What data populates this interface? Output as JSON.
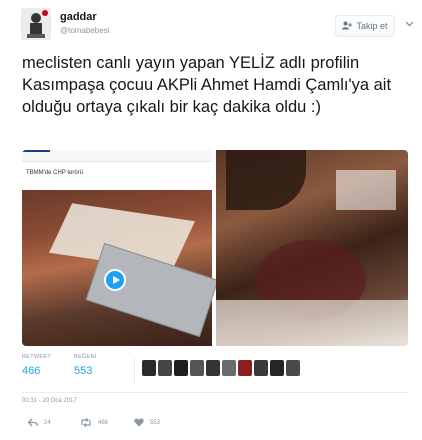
{
  "header": {
    "display_name": "gaddar",
    "handle": "@tomabebesi",
    "follow_label": "Takip et"
  },
  "tweet": {
    "text": "meclisten canlı yayın yapan YELİZ adlı profilin Kasımpaşa çocuu AKPli Ahmet Hamdi Çamlı'ya ait olduğu ortaya çıkalı bir kaç dakika oldu :)"
  },
  "media": {
    "video_caption": "TBMM'de CHP terörü"
  },
  "stats": {
    "retweet_label": "RETWEET",
    "retweet_count": "466",
    "likes_label": "BEĞENİ",
    "likes_count": "553"
  },
  "timestamp": "00:31 - 20 Oca 2017",
  "actions": {
    "reply_count": "24",
    "retweet_count": "466",
    "like_count": "553"
  },
  "icons": {
    "follow": "person-add-icon",
    "menu": "chevron-down-icon",
    "play": "play-icon",
    "reply": "reply-icon",
    "retweet": "retweet-icon",
    "like": "heart-icon"
  },
  "colors": {
    "accent": "#1da1f2",
    "muted": "#8899a6",
    "text": "#14171a"
  }
}
